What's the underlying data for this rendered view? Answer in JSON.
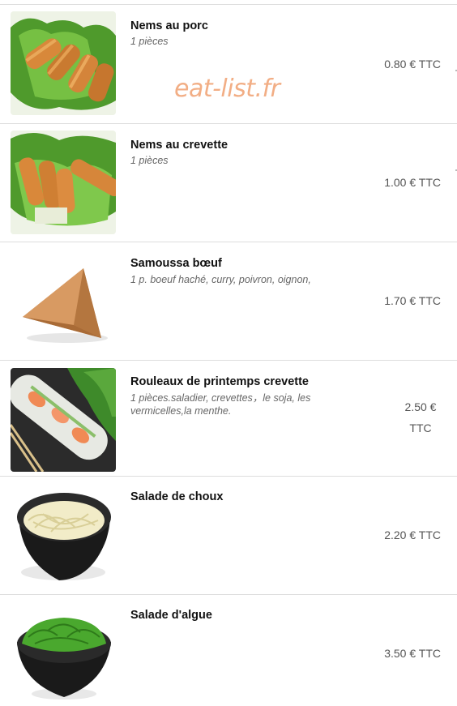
{
  "watermark": "eat-list.fr",
  "items": [
    {
      "name": "Nems au porc",
      "desc": "1 pièces",
      "price": "0.80 € TTC",
      "icon": "spring-rolls-image"
    },
    {
      "name": "Nems au crevette",
      "desc": "1 pièces",
      "price": "1.00 € TTC",
      "icon": "shrimp-spring-rolls-image"
    },
    {
      "name": "Samoussa bœuf",
      "desc": "1 p. boeuf haché, curry, poivron, oignon,",
      "price": "1.70 € TTC",
      "icon": "samosa-image"
    },
    {
      "name": "Rouleaux de printemps crevette",
      "desc": "1 pièces.saladier, crevettes，le soja, les vermicelles,la menthe.",
      "price_line1": "2.50 €",
      "price_line2": "TTC",
      "icon": "fresh-rolls-image"
    },
    {
      "name": "Salade de choux",
      "desc": "",
      "price": "2.20 € TTC",
      "icon": "cabbage-salad-image"
    },
    {
      "name": "Salade d'algue",
      "desc": "",
      "price": "3.50 € TTC",
      "icon": "seaweed-salad-image"
    }
  ]
}
